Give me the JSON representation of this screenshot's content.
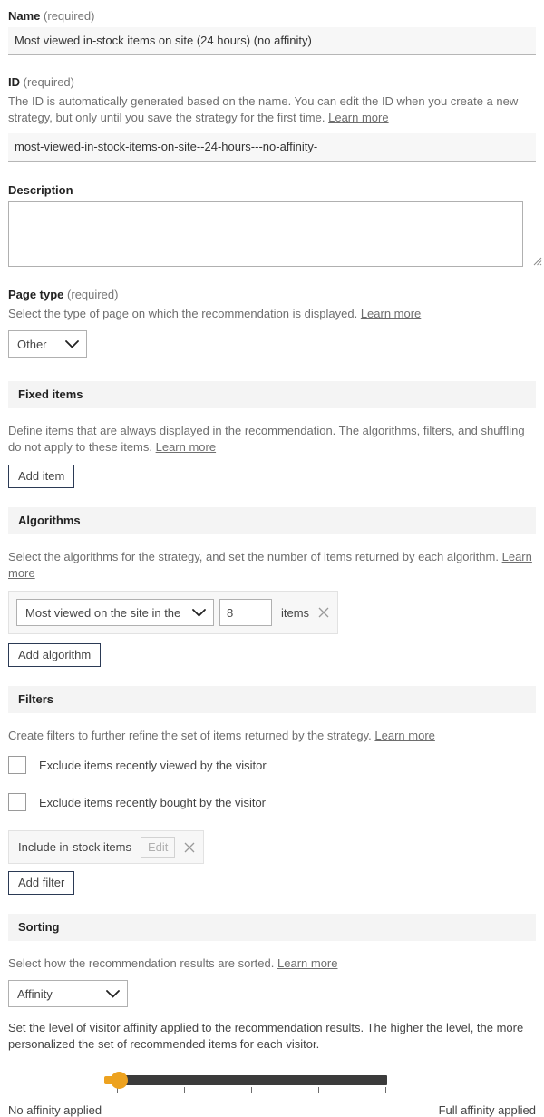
{
  "name_field": {
    "label": "Name",
    "required_suffix": "(required)",
    "value": "Most viewed in-stock items on site (24 hours) (no affinity)"
  },
  "id_field": {
    "label": "ID",
    "required_suffix": "(required)",
    "help": "The ID is automatically generated based on the name. You can edit the ID when you create a new strategy, but only until you save the strategy for the first time.",
    "learn_more": "Learn more",
    "value": "most-viewed-in-stock-items-on-site--24-hours---no-affinity-"
  },
  "description_field": {
    "label": "Description",
    "value": ""
  },
  "page_type": {
    "label": "Page type",
    "required_suffix": "(required)",
    "help": "Select the type of page on which the recommendation is displayed.",
    "learn_more": "Learn more",
    "selected": "Other"
  },
  "fixed_items": {
    "title": "Fixed items",
    "help": "Define items that are always displayed in the recommendation. The algorithms, filters, and shuffling do not apply to these items.",
    "learn_more": "Learn more",
    "add_button": "Add item"
  },
  "algorithms": {
    "title": "Algorithms",
    "help": "Select the algorithms for the strategy, and set the number of items returned by each algorithm.",
    "learn_more": "Learn more",
    "rows": [
      {
        "algorithm": "Most viewed on the site in the pa",
        "count": "8",
        "units": "items",
        "remove_icon": "close-icon"
      }
    ],
    "add_button": "Add algorithm"
  },
  "filters": {
    "title": "Filters",
    "help": "Create filters to further refine the set of items returned by the strategy.",
    "learn_more": "Learn more",
    "checkboxes": [
      {
        "label": "Exclude items recently viewed by the visitor",
        "checked": false
      },
      {
        "label": "Exclude items recently bought by the visitor",
        "checked": false
      }
    ],
    "chips": [
      {
        "label": "Include in-stock items",
        "edit_label": "Edit",
        "remove_icon": "close-icon"
      }
    ],
    "add_button": "Add filter"
  },
  "sorting": {
    "title": "Sorting",
    "help": "Select how the recommendation results are sorted.",
    "learn_more": "Learn more",
    "selected": "Affinity",
    "affinity_help": "Set the level of visitor affinity applied to the recommendation results. The higher the level, the more personalized the set of recommended items for each visitor.",
    "slider": {
      "value": 0,
      "min": 0,
      "max": 5,
      "tick_count": 5,
      "min_label": "No affinity applied",
      "max_label": "Full affinity applied",
      "handle_color": "#eda21f",
      "track_color": "#3b3b3b"
    }
  }
}
